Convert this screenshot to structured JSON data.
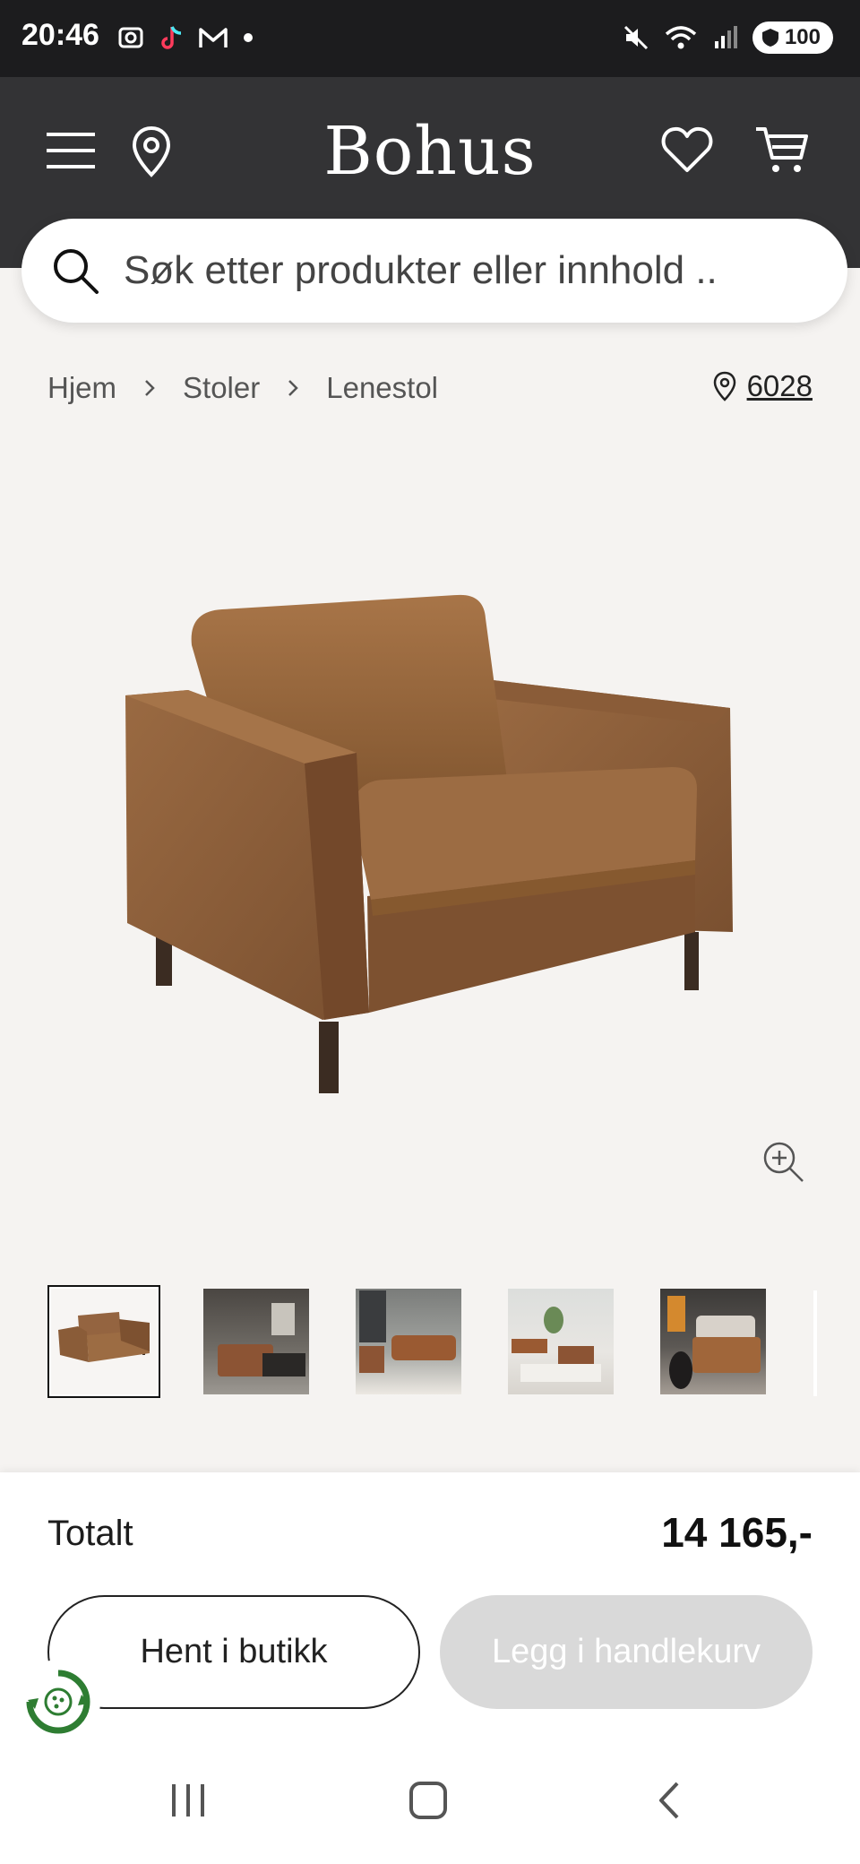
{
  "status": {
    "time": "20:46",
    "battery": "100"
  },
  "header": {
    "logo": "Bohus"
  },
  "search": {
    "placeholder": "Søk etter produkter eller innhold .."
  },
  "breadcrumb": {
    "items": [
      "Hjem",
      "Stoler",
      "Lenestol"
    ]
  },
  "store": {
    "postal_code": "6028"
  },
  "product": {
    "image": "brown-leather-armchair",
    "thumbnails": [
      "armchair-studio",
      "living-room-1",
      "living-room-2",
      "living-room-3",
      "living-room-4"
    ]
  },
  "checkout": {
    "total_label": "Totalt",
    "total_price": "14 165,-",
    "pickup_label": "Hent i butikk",
    "add_to_cart_label": "Legg i handlekurv"
  },
  "colors": {
    "header_bg": "#333335",
    "page_bg": "#f5f3f1",
    "disabled_button": "#d9d9d9",
    "eco_green": "#2e7d32"
  }
}
